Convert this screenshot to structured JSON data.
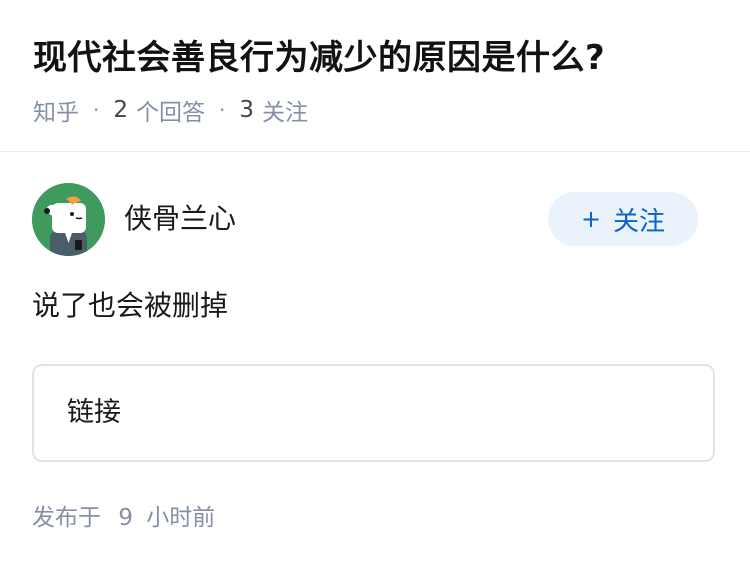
{
  "question": {
    "title": "现代社会善良行为减少的原因是什么?",
    "meta": {
      "source": "知乎",
      "answer_count": "2",
      "answer_label": "个回答",
      "follow_count": "3",
      "follow_label": "关注"
    }
  },
  "answer": {
    "author": {
      "name": "侠骨兰心",
      "avatar_icon": "cartoon-avatar-icon",
      "avatar_bg": "#3f9a5e"
    },
    "follow_button": {
      "icon": "+",
      "label": "关注"
    },
    "content": "说了也会被删掉",
    "link_card": {
      "label": "链接"
    },
    "publish": {
      "prefix": "发布于",
      "value": "9",
      "unit": "小时前"
    }
  },
  "colors": {
    "accent": "#0b63c5",
    "accent_bg": "#eaf2fb",
    "meta_text": "#8590a6",
    "divider": "#ebebeb"
  }
}
